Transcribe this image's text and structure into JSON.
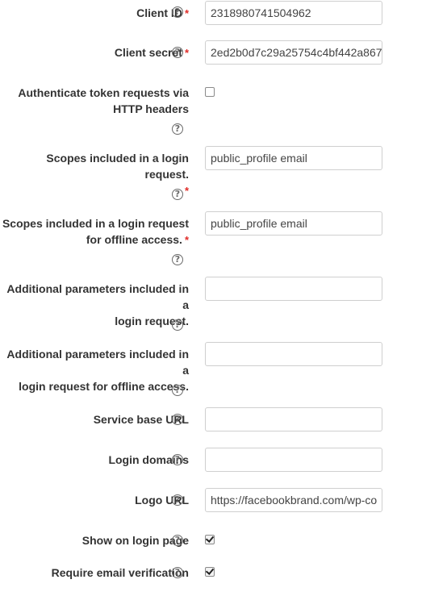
{
  "fields": {
    "client_id": {
      "label": "Client ID",
      "value": "2318980741504962",
      "required": "*"
    },
    "client_secret": {
      "label": "Client secret",
      "value": "2ed2b0d7c29a25754c4bf442a867",
      "required": "*"
    },
    "auth_headers": {
      "label_line1": "Authenticate token requests via",
      "label_line2": "HTTP headers",
      "checked": false
    },
    "scopes_login": {
      "label_line1": "Scopes included in a login request.",
      "value": "public_profile email",
      "required": "*"
    },
    "scopes_offline": {
      "label_line1": "Scopes included in a login request",
      "label_line2": "for offline access.",
      "value": "public_profile email",
      "required": "*"
    },
    "params_login": {
      "label_line1": "Additional parameters included in a",
      "label_line2": "login request.",
      "value": ""
    },
    "params_offline": {
      "label_line1": "Additional parameters included in a",
      "label_line2": "login request for offline access.",
      "value": ""
    },
    "service_base_url": {
      "label": "Service base URL",
      "value": ""
    },
    "login_domains": {
      "label": "Login domains",
      "value": ""
    },
    "logo_url": {
      "label": "Logo URL",
      "value": "https://facebookbrand.com/wp-co"
    },
    "show_on_login": {
      "label": "Show on login page",
      "checked": true
    },
    "require_email": {
      "label": "Require email verification",
      "checked": true
    }
  },
  "help_icon_glyph": "?",
  "icons": {
    "help": "question-circle-icon",
    "check": "checkmark-icon"
  },
  "colors": {
    "required": "#e02b27",
    "text": "#333333",
    "border": "#cfcfcf"
  }
}
